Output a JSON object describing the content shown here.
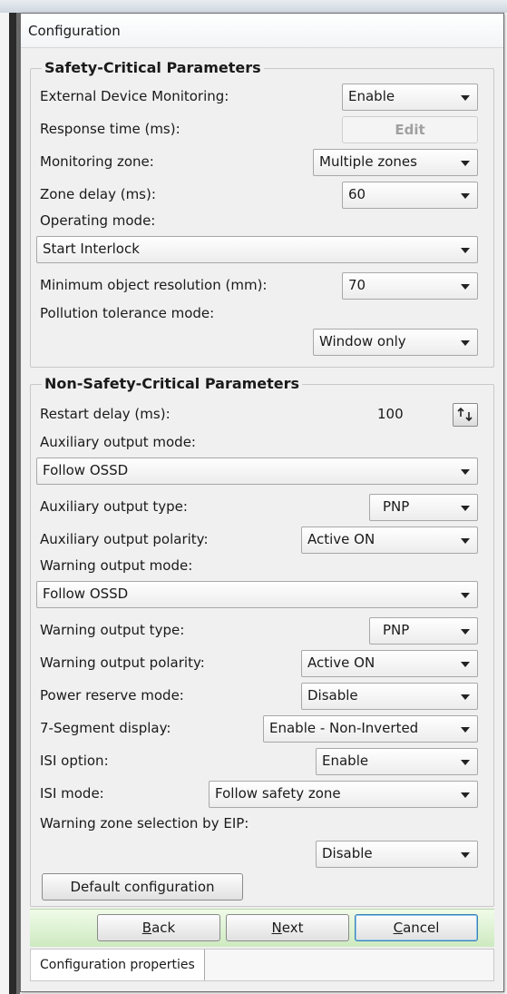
{
  "window": {
    "title": "Configuration"
  },
  "safety": {
    "title": "Safety-Critical Parameters",
    "edm": {
      "label": "External Device Monitoring:",
      "value": "Enable"
    },
    "response_time": {
      "label": "Response time (ms):",
      "button": "Edit"
    },
    "monitoring_zone": {
      "label": "Monitoring zone:",
      "value": "Multiple zones"
    },
    "zone_delay": {
      "label": "Zone delay (ms):",
      "value": "60"
    },
    "operating_mode": {
      "label": "Operating mode:",
      "value": "Start Interlock"
    },
    "min_resolution": {
      "label": "Minimum object resolution (mm):",
      "value": "70"
    },
    "pollution": {
      "label": "Pollution tolerance mode:",
      "value": "Window only"
    }
  },
  "nonsafety": {
    "title": "Non-Safety-Critical Parameters",
    "restart_delay": {
      "label": "Restart delay (ms):",
      "value": "100"
    },
    "aux_mode": {
      "label": "Auxiliary output mode:",
      "value": "Follow OSSD"
    },
    "aux_type": {
      "label": "Auxiliary output type:",
      "value": "PNP"
    },
    "aux_polarity": {
      "label": "Auxiliary output polarity:",
      "value": "Active ON"
    },
    "warn_mode": {
      "label": "Warning output mode:",
      "value": "Follow OSSD"
    },
    "warn_type": {
      "label": "Warning output type:",
      "value": "PNP"
    },
    "warn_polarity": {
      "label": "Warning output polarity:",
      "value": "Active ON"
    },
    "power_reserve": {
      "label": "Power reserve mode:",
      "value": "Disable"
    },
    "seg_display": {
      "label": "7-Segment display:",
      "value": "Enable - Non-Inverted"
    },
    "isi_option": {
      "label": "ISI option:",
      "value": "Enable"
    },
    "isi_mode": {
      "label": "ISI mode:",
      "value": "Follow safety zone"
    },
    "warn_zone_eip": {
      "label": "Warning zone selection by EIP:",
      "value": "Disable"
    },
    "default_config": "Default configuration"
  },
  "nav": {
    "back_first": "B",
    "back_rest": "ack",
    "next_first": "N",
    "next_rest": "ext",
    "cancel_first": "C",
    "cancel_rest": "ancel"
  },
  "status": {
    "tab": "Configuration properties"
  },
  "icons": {
    "dropdown": "chevron-down-icon",
    "spinner": "spin-up-down-icon"
  },
  "colors": {
    "nav_bar": "#cdeac0",
    "dialog_bg": "#f0f0f0"
  }
}
